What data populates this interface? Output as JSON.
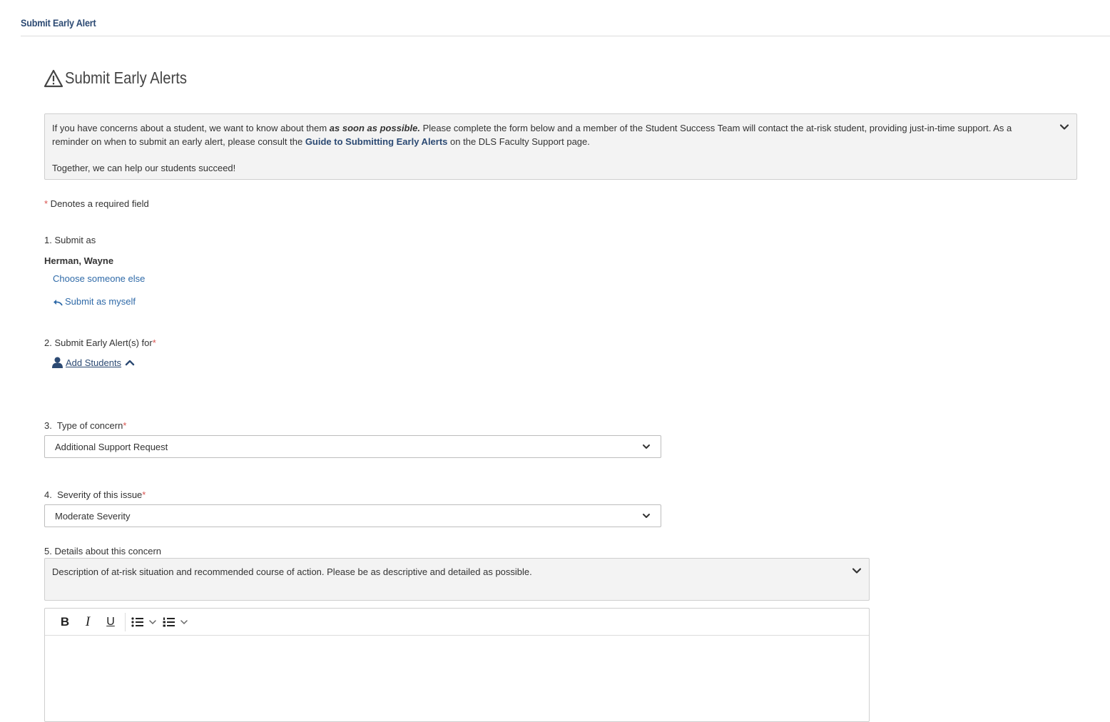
{
  "breadcrumb": {
    "title": "Submit Early Alert"
  },
  "page": {
    "title": "Submit Early Alerts"
  },
  "info": {
    "text_before": "If you have concerns about a student, we want to know about them ",
    "emphasis": "as soon as possible.",
    "text_mid": " Please complete the form below and a member of the Student Success Team will contact the at-risk student, providing just-in-time support. As a reminder on when to submit an early alert, please consult the ",
    "link": "Guide to Submitting Early Alerts",
    "text_after": " on the DLS Faculty Support page.",
    "closing": "Together, we can help our students succeed!"
  },
  "required_note": {
    "star": "*",
    "text": " Denotes a required field"
  },
  "q1": {
    "label": "1. Submit as",
    "submitter": "Herman, Wayne",
    "choose_link": "Choose someone else",
    "myself_link": "Submit as myself"
  },
  "q2": {
    "label": "2. Submit Early Alert(s) for",
    "star": "*",
    "add_students": "Add Students"
  },
  "q3": {
    "label": "3.  Type of concern",
    "star": "*",
    "selected": "Additional Support Request"
  },
  "q4": {
    "label": "4.  Severity of this issue",
    "star": "*",
    "selected": "Moderate Severity"
  },
  "q5": {
    "label": "5. Details about this concern",
    "hint": "Description of at-risk situation and recommended course of action. Please be as descriptive and detailed as possible."
  },
  "editor": {
    "bold": "B",
    "italic": "I",
    "underline": "U"
  },
  "colors": {
    "primary": "#2c4a73",
    "link": "#2f6aa8",
    "required": "#d9534f",
    "panel": "#f3f3f3"
  }
}
